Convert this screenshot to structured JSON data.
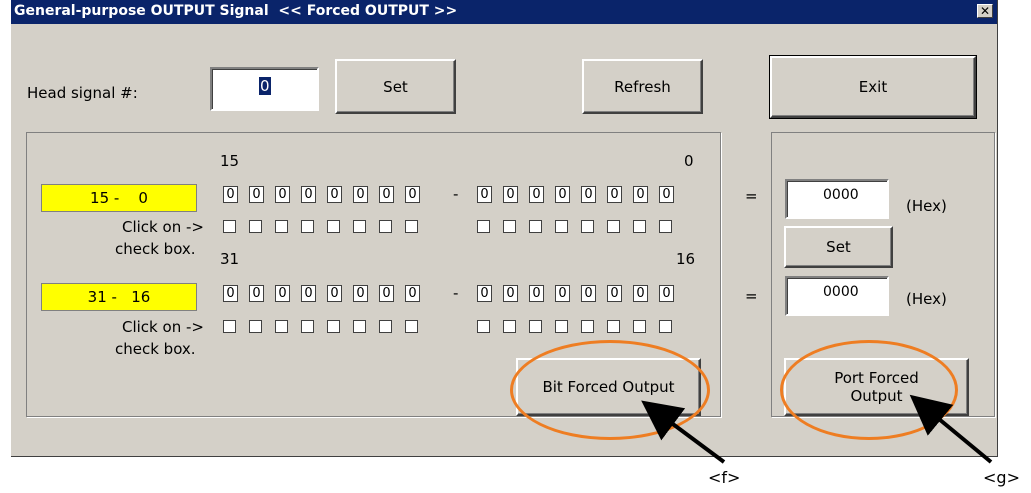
{
  "window": {
    "title": "General-purpose OUTPUT Signal  << Forced OUTPUT >>",
    "close_glyph": "✕"
  },
  "head": {
    "label": "Head signal #:",
    "value": "0",
    "set_label": "Set",
    "refresh_label": "Refresh",
    "exit_label": "Exit"
  },
  "bits": {
    "row1": {
      "range_label": "15 -    0",
      "high": "15",
      "low": "0",
      "values": [
        "0",
        "0",
        "0",
        "0",
        "0",
        "0",
        "0",
        "0",
        "0",
        "0",
        "0",
        "0",
        "0",
        "0",
        "0",
        "0"
      ]
    },
    "row2": {
      "range_label": "31 -   16",
      "high": "31",
      "low": "16",
      "values": [
        "0",
        "0",
        "0",
        "0",
        "0",
        "0",
        "0",
        "0",
        "0",
        "0",
        "0",
        "0",
        "0",
        "0",
        "0",
        "0"
      ]
    },
    "click_hint": "Click on ->",
    "check_hint": "check box.",
    "bit_forced_label": "Bit Forced Output"
  },
  "port": {
    "eq": "=",
    "hex1": "0000",
    "hex2": "0000",
    "hex_unit": "(Hex)",
    "set_label": "Set",
    "port_forced_line1": "Port Forced",
    "port_forced_line2": "Output"
  },
  "annotations": {
    "f": "<f>",
    "g": "<g>",
    "accent_color": "#ee7d22",
    "arrow_color": "#000000"
  }
}
